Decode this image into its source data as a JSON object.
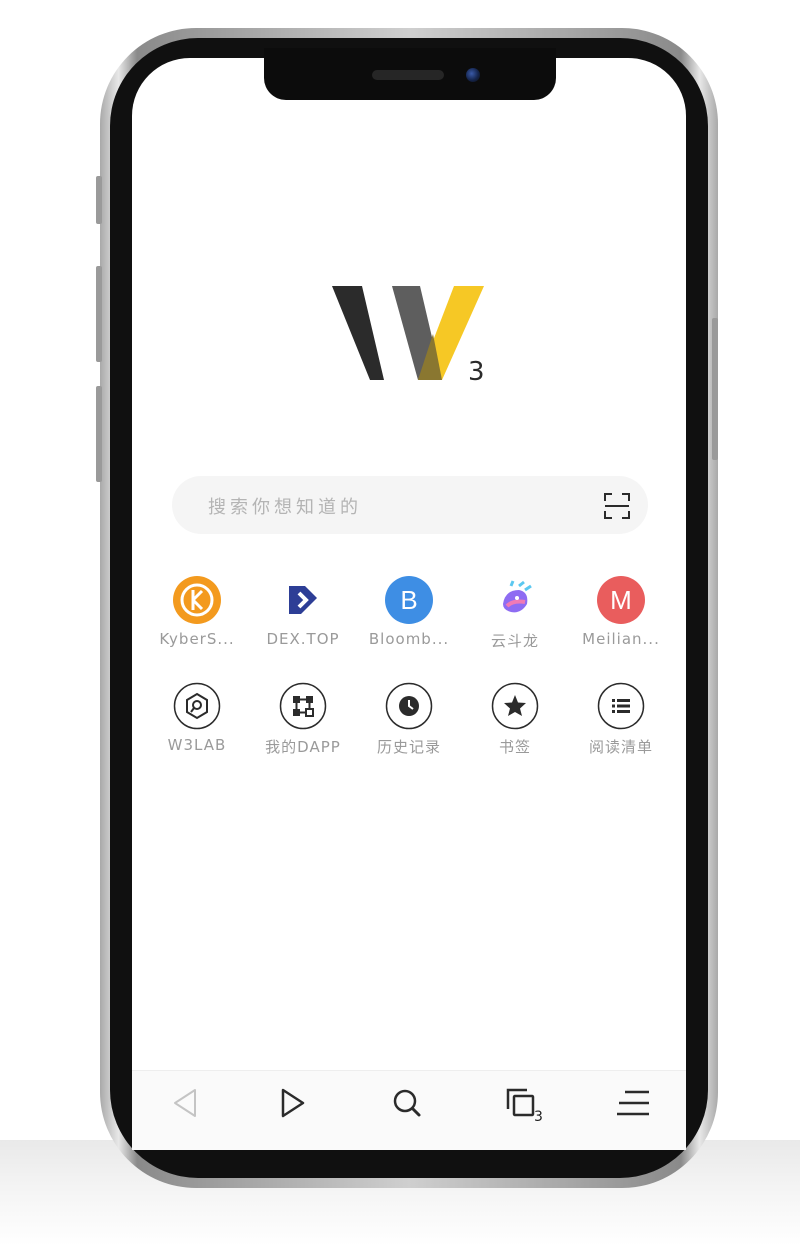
{
  "logo": {
    "mark": "W",
    "superscript": "3"
  },
  "search": {
    "placeholder": "搜索你想知道的"
  },
  "quick_links": [
    {
      "label": "KyberS...",
      "icon": "kyber-logo-icon",
      "color": "#f39a1e"
    },
    {
      "label": "DEX.TOP",
      "icon": "dex-top-logo-icon",
      "color": "#2d3e96"
    },
    {
      "label": "Bloomb...",
      "icon": "bloomberg-logo-icon",
      "color": "#3e8ee4",
      "letter": "B"
    },
    {
      "label": "云斗龙",
      "icon": "dragon-logo-icon",
      "color": "#7b5cf0"
    },
    {
      "label": "Meilian...",
      "icon": "meilian-logo-icon",
      "color": "#e95d5d",
      "letter": "M"
    }
  ],
  "tools": [
    {
      "label": "W3LAB",
      "icon": "w3lab-icon"
    },
    {
      "label": "我的DAPP",
      "icon": "dapp-icon"
    },
    {
      "label": "历史记录",
      "icon": "history-clock-icon"
    },
    {
      "label": "书签",
      "icon": "bookmark-star-icon"
    },
    {
      "label": "阅读清单",
      "icon": "reading-list-icon"
    }
  ],
  "bottom_nav": {
    "tab_count": "3",
    "items": [
      "back-icon",
      "forward-icon",
      "search-icon",
      "tabs-icon",
      "menu-icon"
    ]
  },
  "colors": {
    "logo_dark": "#2b2b2b",
    "logo_gray": "#5e5e5e",
    "logo_yellow": "#f6c825",
    "label_gray": "#9a9a9a"
  }
}
